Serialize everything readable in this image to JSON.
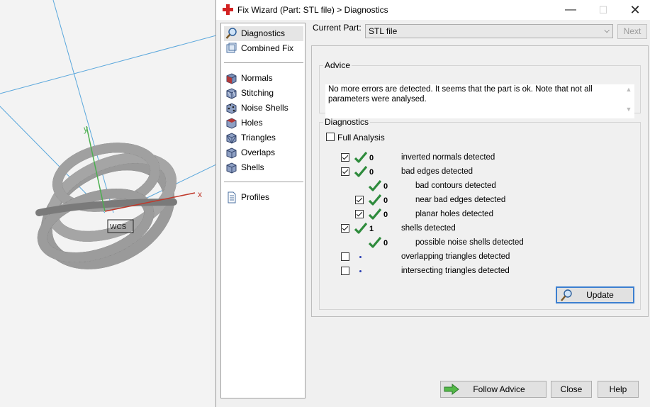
{
  "viewport": {
    "axis_x_label": "x",
    "axis_y_label": "y",
    "part_label": "WCS"
  },
  "window": {
    "title": "Fix Wizard (Part: STL file) > Diagnostics",
    "controls": {
      "minimize": "—",
      "maximize": "☐",
      "close": "✕"
    }
  },
  "nav": {
    "items": [
      {
        "label": "Diagnostics",
        "icon": "magnifier-icon",
        "selected": true
      },
      {
        "label": "Combined Fix",
        "icon": "combined-fix-icon"
      },
      {
        "label": "Normals",
        "icon": "normals-cube-icon"
      },
      {
        "label": "Stitching",
        "icon": "stitching-cube-icon"
      },
      {
        "label": "Noise Shells",
        "icon": "noise-shells-cube-icon"
      },
      {
        "label": "Holes",
        "icon": "holes-cube-icon"
      },
      {
        "label": "Triangles",
        "icon": "triangles-cube-icon"
      },
      {
        "label": "Overlaps",
        "icon": "overlaps-cube-icon"
      },
      {
        "label": "Shells",
        "icon": "shells-cube-icon"
      },
      {
        "label": "Profiles",
        "icon": "profiles-document-icon"
      }
    ]
  },
  "current_part": {
    "label": "Current Part:",
    "value": "STL file",
    "next_label": "Next"
  },
  "advice": {
    "title": "Advice",
    "text": "No more errors are detected. It seems that the part is ok. Note that not all parameters were analysed."
  },
  "diagnostics": {
    "title": "Diagnostics",
    "full_analysis_label": "Full Analysis",
    "full_analysis_checked": false,
    "rows": [
      {
        "checkbox": true,
        "checked": true,
        "status": "ok",
        "count": "0",
        "label": "inverted normals detected"
      },
      {
        "checkbox": true,
        "checked": true,
        "status": "ok",
        "count": "0",
        "label": "bad edges detected"
      },
      {
        "checkbox": false,
        "checked": false,
        "status": "ok",
        "count": "0",
        "label": "bad contours detected",
        "indent": true
      },
      {
        "checkbox": true,
        "checked": true,
        "status": "ok",
        "count": "0",
        "label": "near bad edges detected",
        "indent": true
      },
      {
        "checkbox": true,
        "checked": true,
        "status": "ok",
        "count": "0",
        "label": "planar holes detected",
        "indent": true
      },
      {
        "checkbox": true,
        "checked": true,
        "status": "ok",
        "count": "1",
        "label": "shells detected"
      },
      {
        "checkbox": false,
        "checked": false,
        "status": "ok",
        "count": "0",
        "label": "possible noise shells detected",
        "indent": true
      },
      {
        "checkbox": true,
        "checked": false,
        "status": "none",
        "count": "",
        "label": "overlapping triangles detected"
      },
      {
        "checkbox": true,
        "checked": false,
        "status": "none",
        "count": "",
        "label": "intersecting triangles detected"
      }
    ],
    "update_label": "Update"
  },
  "footer": {
    "follow_advice_label": "Follow Advice",
    "close_label": "Close",
    "help_label": "Help"
  },
  "colors": {
    "check_green": "#2e8b3c",
    "axis_x": "#c0392b",
    "axis_y": "#4caf50",
    "axis_z": "#3f8fd0",
    "focus_blue": "#3c7fd0"
  }
}
